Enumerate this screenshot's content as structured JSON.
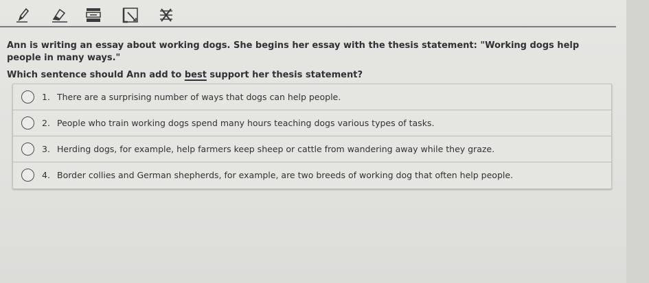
{
  "toolbar": {
    "tools": [
      {
        "icon": "pencil-icon"
      },
      {
        "icon": "eraser-icon"
      },
      {
        "icon": "line-reader-icon"
      },
      {
        "icon": "annotate-icon"
      },
      {
        "icon": "answer-eliminator-icon"
      }
    ]
  },
  "stem": "Ann is writing an essay about working dogs. She begins her essay with the thesis statement: \"Working dogs help people in many ways.\"",
  "question": {
    "before": "Which sentence should Ann add to ",
    "emphasis": "best",
    "after": " support her thesis statement?"
  },
  "choices": [
    {
      "number": "1.",
      "text": "There are a surprising number of ways that dogs can help people."
    },
    {
      "number": "2.",
      "text": "People who train working dogs spend many hours teaching dogs various types of tasks."
    },
    {
      "number": "3.",
      "text": "Herding dogs, for example, help farmers keep sheep or cattle from wandering away while they graze."
    },
    {
      "number": "4.",
      "text": "Border collies and German shepherds, for example, are two breeds of working dog that often help people."
    }
  ]
}
